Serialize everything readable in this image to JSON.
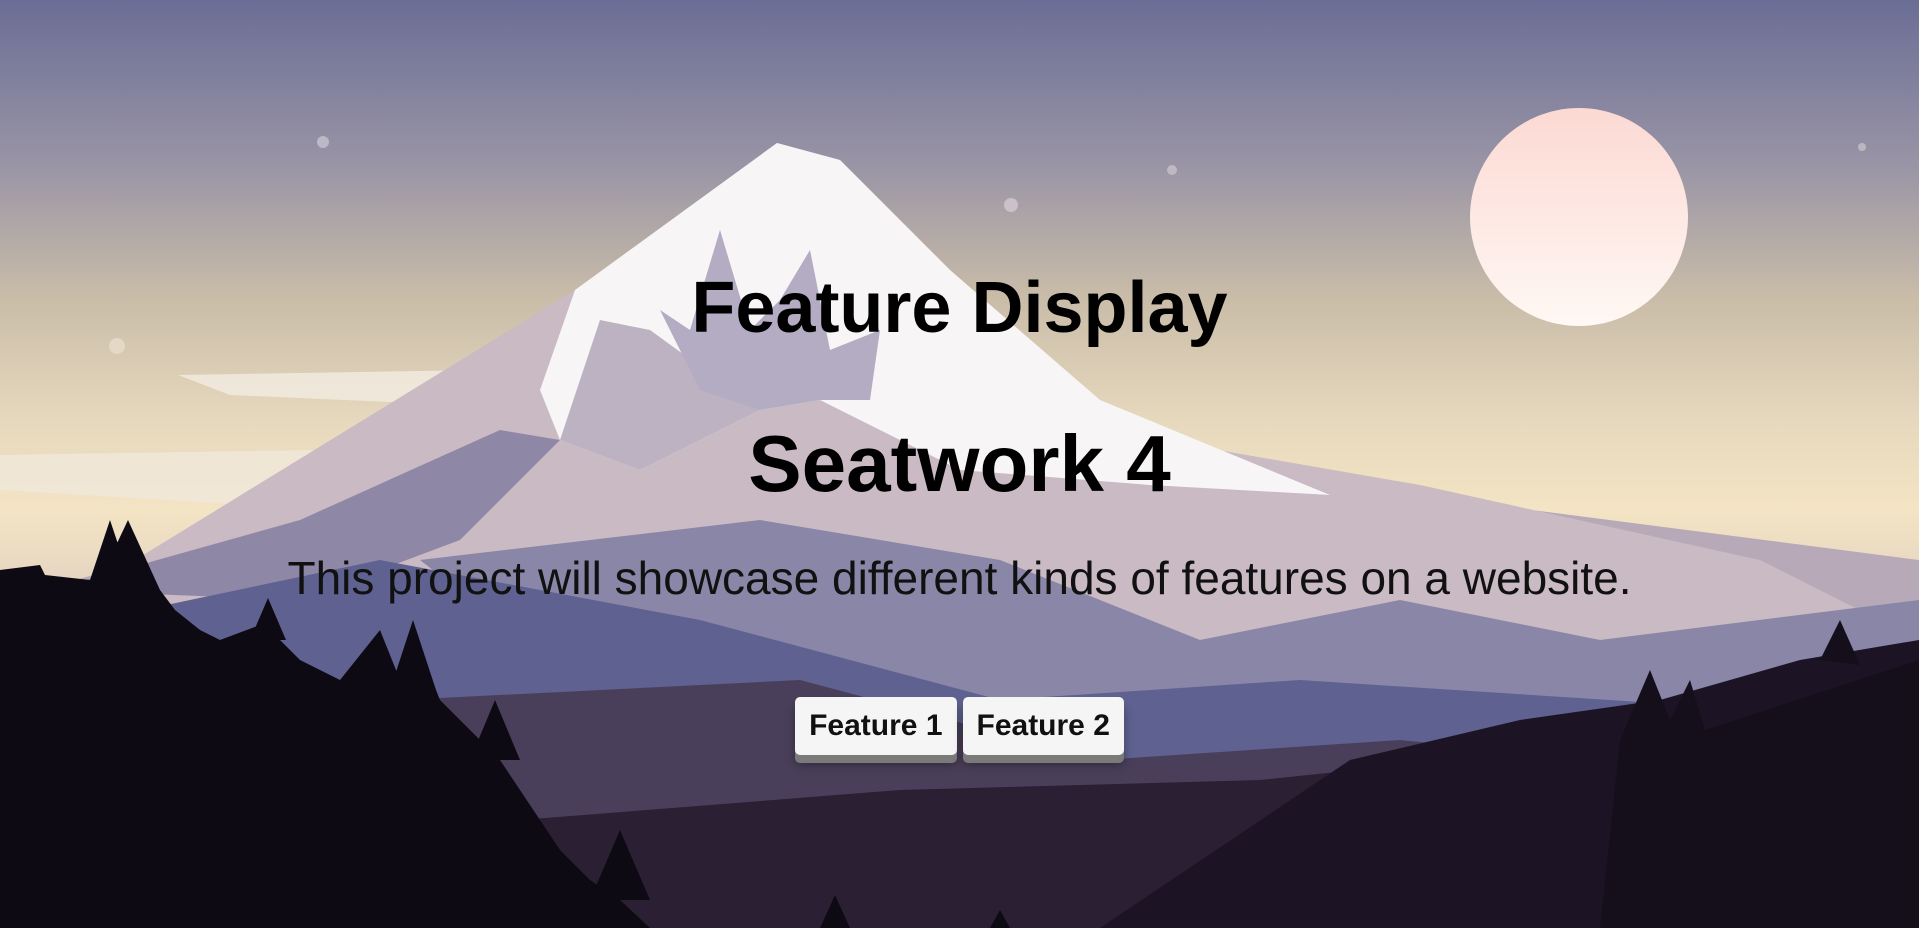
{
  "page": {
    "title": "Feature Display",
    "subtitle": "Seatwork 4",
    "description": "This project will showcase different kinds of features on a website."
  },
  "buttons": {
    "feature1_label": "Feature 1",
    "feature2_label": "Feature 2"
  },
  "colors": {
    "sky_top": "#6a6d95",
    "sky_horizon": "#f3e4c4",
    "moon": "#fde6e0",
    "snow": "#f7f5f6",
    "forest": "#0e0a14"
  }
}
